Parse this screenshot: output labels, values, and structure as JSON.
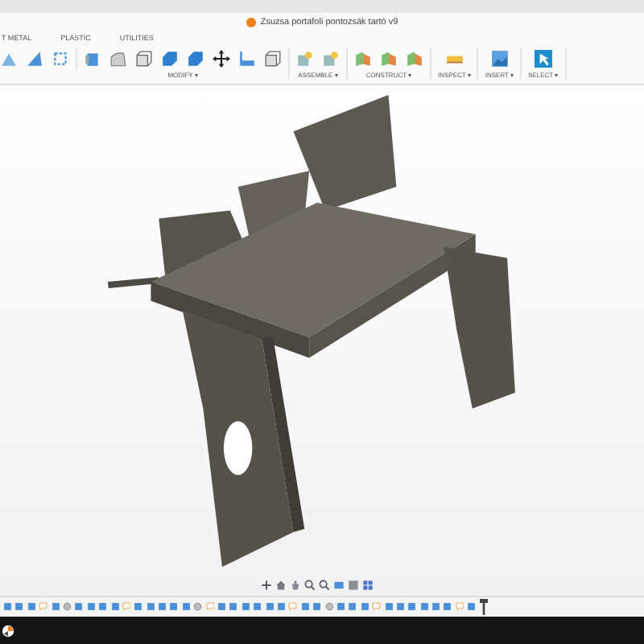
{
  "window": {
    "title": "Zsuzsa portafoli pontozsák tartó v9"
  },
  "tabs": [
    {
      "label": "T METAL",
      "selected": false
    },
    {
      "label": "PLASTIC",
      "selected": false
    },
    {
      "label": "UTILITIES",
      "selected": false
    }
  ],
  "toolbar_groups": [
    {
      "label": "MODIFY ▾"
    },
    {
      "label": "ASSEMBLE ▾"
    },
    {
      "label": "CONSTRUCT ▾"
    },
    {
      "label": "INSPECT ▾"
    },
    {
      "label": "INSERT ▾"
    },
    {
      "label": "SELECT ▾"
    }
  ]
}
